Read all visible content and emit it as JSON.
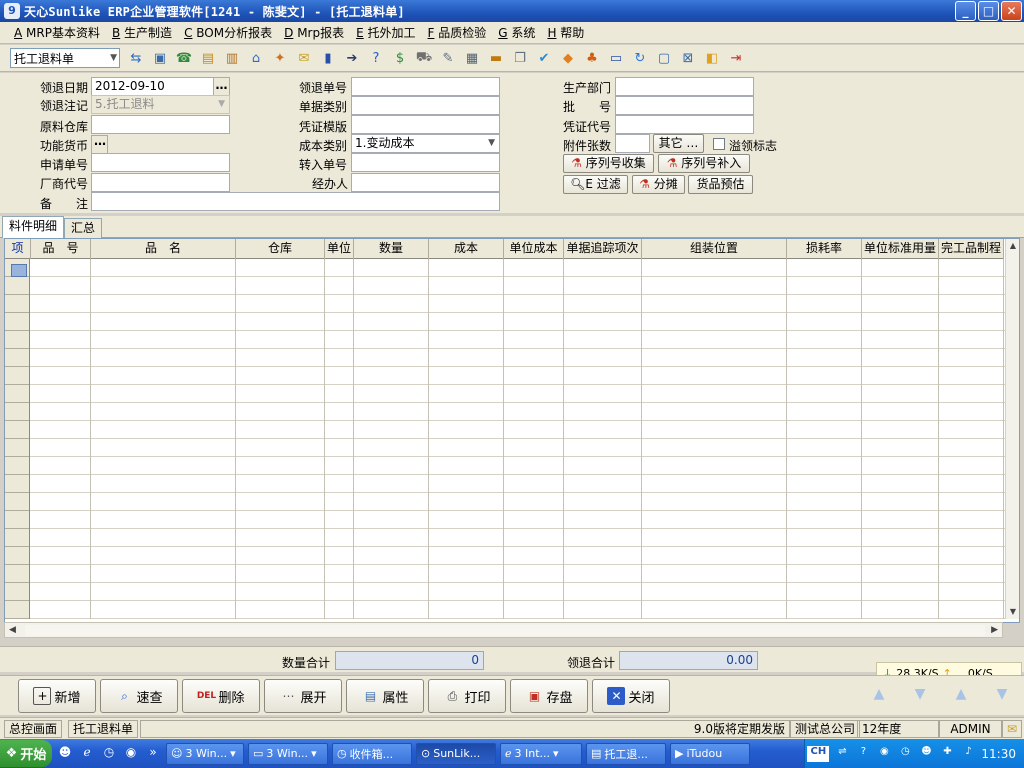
{
  "window": {
    "title": "天心Sunlike ERP企业管理软件[1241 - 陈斐文] - [托工退料单]",
    "min": "_",
    "max": "□",
    "close": "✕"
  },
  "menu": [
    {
      "key": "A",
      "label": "MRP基本资料"
    },
    {
      "key": "B",
      "label": "生产制造"
    },
    {
      "key": "C",
      "label": "BOM分析报表"
    },
    {
      "key": "D",
      "label": "Mrp报表"
    },
    {
      "key": "E",
      "label": "托外加工"
    },
    {
      "key": "F",
      "label": "品质检验"
    },
    {
      "key": "G",
      "label": "系统"
    },
    {
      "key": "H",
      "label": "帮助"
    }
  ],
  "toolbar": {
    "doc_select": "托工退料单",
    "icons": [
      "switch-icon",
      "computer-icon",
      "phone-icon",
      "folder-user-icon",
      "briefcase-icon",
      "home-icon",
      "network-icon",
      "mail-icon",
      "book-icon",
      "arrow-icon",
      "help-icon",
      "money-icon",
      "cart-icon",
      "document-edit-icon",
      "calculator-icon",
      "box-icon",
      "copy-icon",
      "check-icon",
      "bell-icon",
      "tree-icon",
      "monitor-icon",
      "refresh-icon",
      "window-icon",
      "close-window-icon",
      "tiles-icon",
      "exit-icon"
    ]
  },
  "form": {
    "return_date_label": "领退日期",
    "return_date": "2012-09-10",
    "return_note_label": "领退注记",
    "return_note": "5.托工退料",
    "warehouse_label": "原料仓库",
    "warehouse": "",
    "currency_label": "功能货币",
    "currency": "",
    "apply_no_label": "申请单号",
    "apply_no": "",
    "vendor_code_label": "厂商代号",
    "vendor_code": "",
    "remark_label": "备　　注",
    "remark": "",
    "return_no_label": "领退单号",
    "return_no": "",
    "doc_type_label": "单据类别",
    "doc_type": "",
    "voucher_template_label": "凭证模版",
    "voucher_template": "",
    "cost_type_label": "成本类别",
    "cost_type": "1.变动成本",
    "transfer_no_label": "转入单号",
    "transfer_no": "",
    "handler_label": "经办人",
    "handler": "",
    "dept_label": "生产部门",
    "dept": "",
    "batch_label": "批　　号",
    "batch": "",
    "voucher_code_label": "凭证代号",
    "voucher_code": "",
    "attach_label": "附件张数",
    "attach": "",
    "other_button": "其它 …",
    "overdraw_label": "溢领标志",
    "serial_collect": "序列号收集",
    "serial_append": "序列号补入",
    "filter": "E 过滤",
    "allocate": "分摊",
    "estimate": "货品预估"
  },
  "tabs": [
    "料件明细",
    "汇总"
  ],
  "grid": {
    "columns": [
      "项",
      "品　号",
      "品　名",
      "仓库",
      "单位",
      "数量",
      "成本",
      "单位成本",
      "单据追踪项次",
      "组装位置",
      "损耗率",
      "单位标准用量",
      "完工品制程"
    ],
    "rows": 20
  },
  "totals": {
    "qty_label": "数量合计",
    "qty_value": "0",
    "amount_label": "领退合计",
    "amount_value": "0.00"
  },
  "buttons": [
    "新增",
    "速查",
    "删除",
    "展开",
    "属性",
    "打印",
    "存盘",
    "关闭"
  ],
  "button_icons": [
    "new-icon",
    "search-icon",
    "delete-icon",
    "expand-icon",
    "properties-icon",
    "print-icon",
    "save-icon",
    "close-icon"
  ],
  "speed": {
    "down": "28.3K/S",
    "up": "0K/S"
  },
  "status": {
    "home": "总控画面",
    "current": "托工退料单",
    "version": "9.0版将定期发版",
    "company": "测试总公司",
    "year": "12年度",
    "user": "ADMIN"
  },
  "taskbar": {
    "start": "开始",
    "tasks": [
      "3 Win...",
      "3 Win...",
      "收件箱...",
      "SunLik...",
      "3 Int...",
      "托工退...",
      "iTudou"
    ],
    "lang": "CH",
    "clock": "11:30"
  },
  "colors": {
    "title_bar": "#1f54b8",
    "taskbar": "#245dd0",
    "total_text": "#1c3f8f"
  }
}
